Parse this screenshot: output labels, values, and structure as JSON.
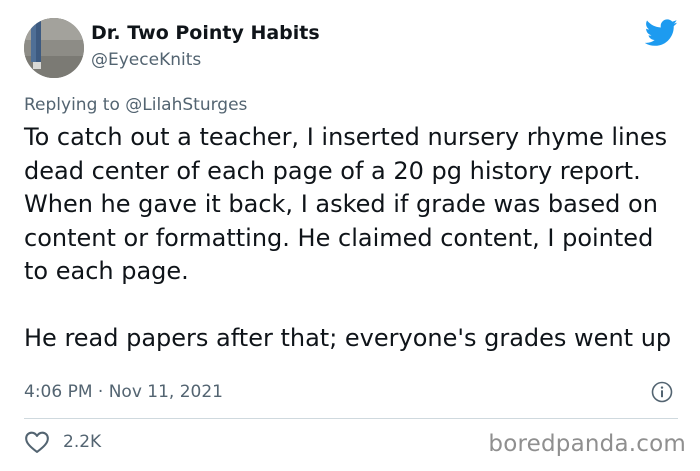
{
  "author": {
    "display_name": "Dr. Two Pointy Habits",
    "handle": "@EyeceKnits"
  },
  "reply": {
    "prefix": "Replying to",
    "mention": "@LilahSturges"
  },
  "tweet": {
    "paragraph_1": "To catch out a teacher, I inserted nursery rhyme lines dead center of each page of a 20 pg history report. When he gave it back, I asked if grade was based on content or formatting. He claimed content, I pointed to each page.",
    "paragraph_2": "He read papers after that; everyone's grades went up"
  },
  "meta": {
    "timestamp": "4:06 PM · Nov 11, 2021"
  },
  "engagement": {
    "likes": "2.2K"
  },
  "watermark": "boredpanda.com",
  "icons": {
    "brand": "twitter-bird-icon",
    "info": "info-icon",
    "like": "heart-icon"
  },
  "colors": {
    "twitter_blue": "#1d9bf0",
    "text_primary": "#0f1419",
    "text_secondary": "#536471",
    "divider": "#cfd9de"
  }
}
